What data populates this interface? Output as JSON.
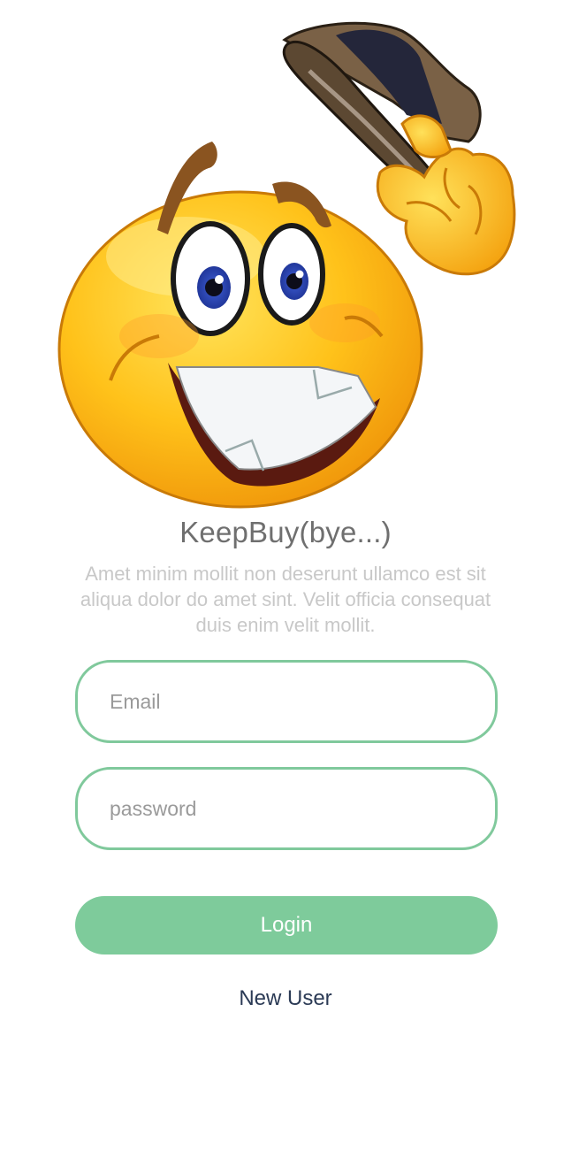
{
  "hero": {
    "icon": "smiley-tipping-hat-icon"
  },
  "app": {
    "title": "KeepBuy(bye...)",
    "description": "Amet minim mollit non deserunt ullamco est sit aliqua dolor do amet sint. Velit officia consequat duis enim velit mollit."
  },
  "form": {
    "email_placeholder": "Email",
    "email_value": "",
    "password_placeholder": "password",
    "password_value": "",
    "login_label": "Login",
    "new_user_label": "New User"
  },
  "colors": {
    "accent": "#7ecb9b",
    "field_border": "#80c99c",
    "title": "#6f6f6f",
    "description": "#c8c8c8",
    "link": "#2b3a55"
  }
}
